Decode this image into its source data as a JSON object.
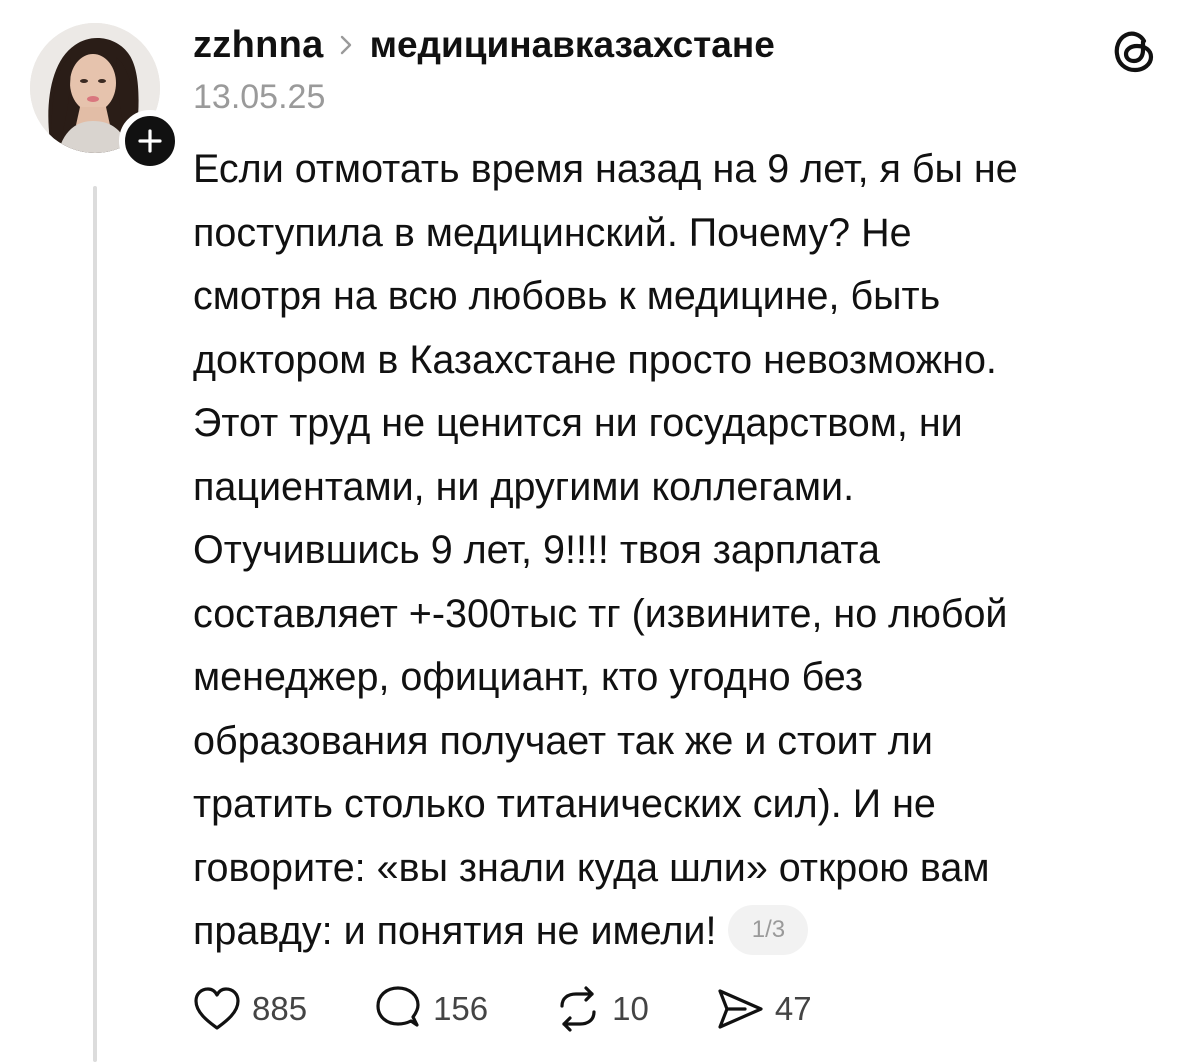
{
  "post": {
    "author": "zzhnna",
    "community": "медицинавказахстане",
    "date": "13.05.25",
    "text": "Если отмотать время назад на 9 лет, я бы не\nпоступила в медицинский. Почему? Не\nсмотря на всю любовь к медицине, быть\nдоктором в Казахстане просто невозможно.\nЭтот труд не ценится ни государством, ни\nпациентами, ни другими коллегами.\nОтучившись 9 лет, 9!!!! твоя зарплата\nсоставляет +-300тыс тг (извините, но любой\nменеджер, официант, кто угодно без\nобразования получает так же и стоит ли\nтратить столько титанических сил). И не\nговорите: «вы знали куда шли» открою вам\nправду: и понятия не имели!",
    "page_indicator": "1/3"
  },
  "actions": {
    "likes": "885",
    "comments": "156",
    "reposts": "10",
    "shares": "47"
  },
  "icons": {
    "brand": "threads-logo-icon",
    "follow": "plus-icon",
    "like": "heart-icon",
    "comment": "comment-icon",
    "repost": "repost-icon",
    "share": "send-icon"
  },
  "colors": {
    "text": "#111111",
    "muted": "#9a9a9a",
    "thread_line": "#dcdcdc",
    "badge_bg": "#f2f2f2"
  }
}
